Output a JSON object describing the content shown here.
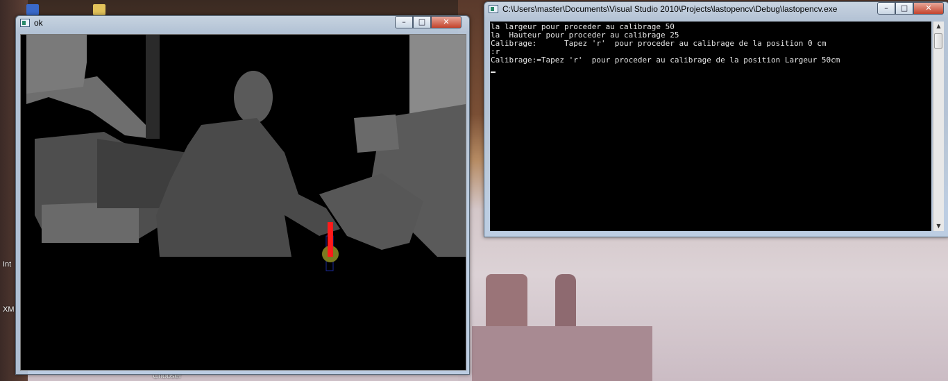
{
  "desktop": {
    "labels": [
      "Int",
      "XM",
      "Chooser"
    ]
  },
  "opencv_window": {
    "title": "ok",
    "controls": {
      "minimize": "–",
      "maximize": "□",
      "close": "✕"
    },
    "icon": "app-window-icon"
  },
  "console_window": {
    "title": "C:\\Users\\master\\Documents\\Visual Studio 2010\\Projects\\lastopencv\\Debug\\lastopencv.exe",
    "controls": {
      "minimize": "–",
      "maximize": "□",
      "close": "✕"
    },
    "icon": "console-window-icon",
    "lines": [
      "la largeur pour proceder au calibrage 50",
      "la  Hauteur pour proceder au calibrage 25",
      "Calibrage:      Tapez 'r'  pour proceder au calibrage de la position 0 cm",
      ":r",
      "Calibrage:=Tapez 'r'  pour proceder au calibrage de la position Largeur 50cm"
    ],
    "scroll_up": "▲",
    "scroll_down": "▼"
  },
  "colors": {
    "console_bg": "#000000",
    "console_text": "#e6e6e6",
    "marker_red": "#ff1a1a",
    "marker_olive": "#7a7a20",
    "box_blue": "#1a2a9a"
  }
}
